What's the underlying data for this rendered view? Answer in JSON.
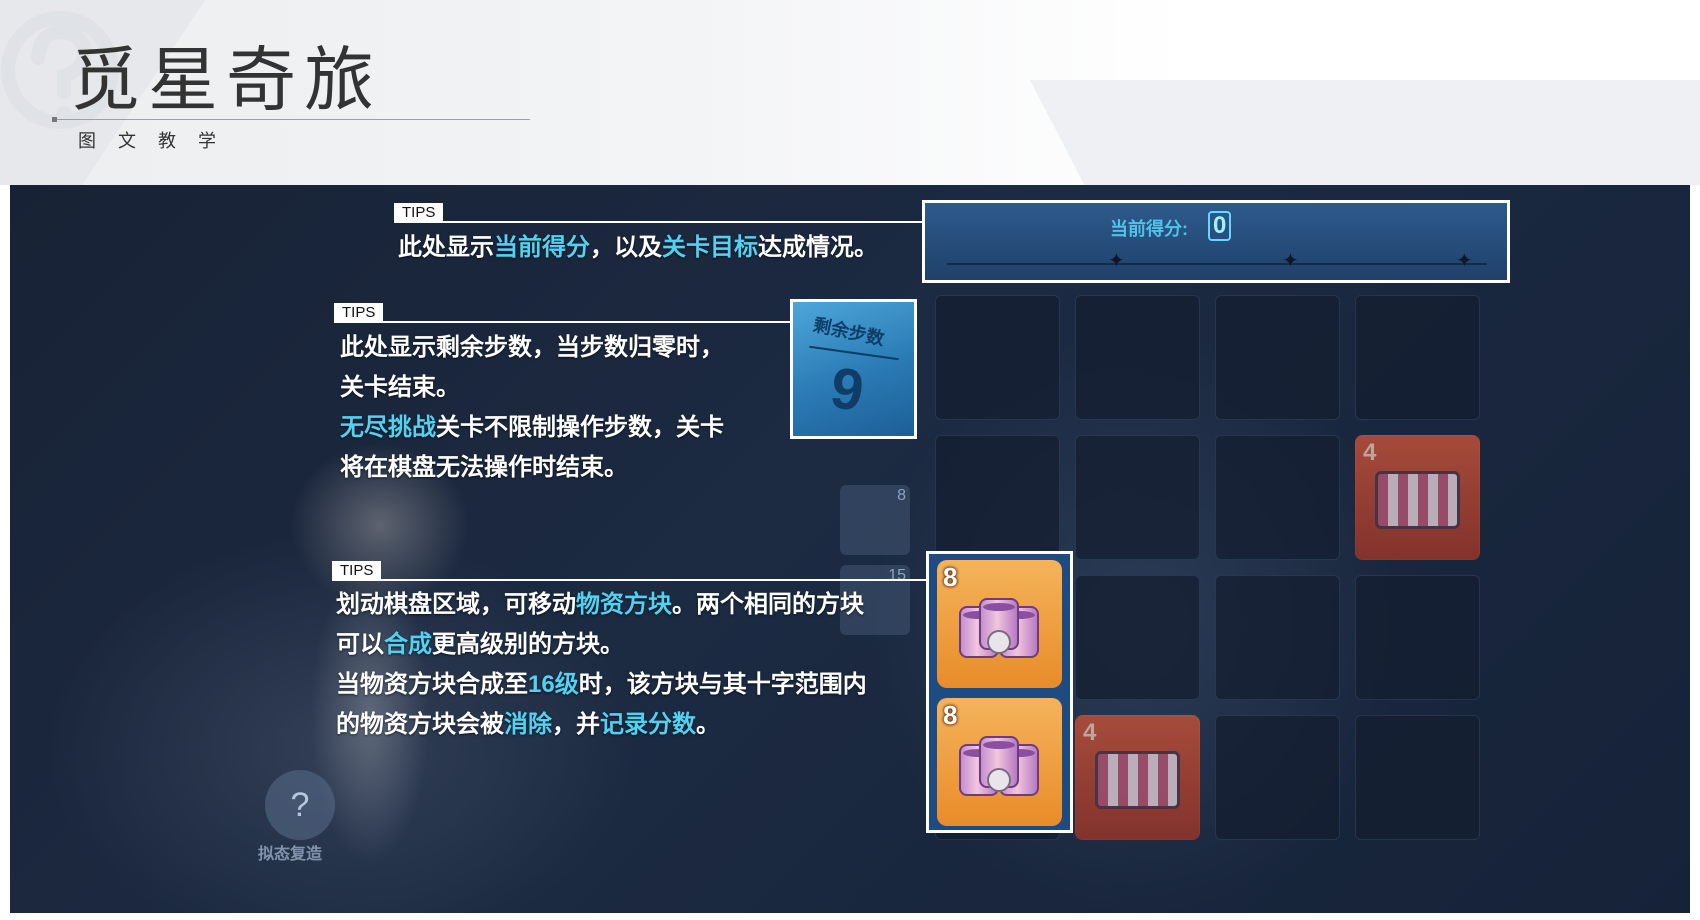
{
  "header": {
    "title": "觅星奇旅",
    "subtitle": "图文教学"
  },
  "game": {
    "score": {
      "label": "当前得分:",
      "value": "0"
    },
    "steps": {
      "label": "剩余步数",
      "value": "9"
    },
    "board_tiles": [
      {
        "level": "4"
      },
      {
        "level": "4"
      }
    ],
    "side_slots": [
      {
        "count": "8"
      },
      {
        "count": "15"
      }
    ],
    "stack_tiles": [
      {
        "level": "8"
      },
      {
        "level": "8"
      }
    ],
    "skill": {
      "icon": "question-card-icon",
      "label": "拟态复造"
    }
  },
  "tips": [
    {
      "tag": "TIPS",
      "lines": [
        [
          {
            "t": "此处显示"
          },
          {
            "t": "当前得分",
            "hl": true
          },
          {
            "t": "，以及"
          },
          {
            "t": "关卡目标",
            "hl": true
          },
          {
            "t": "达成情况。"
          }
        ]
      ]
    },
    {
      "tag": "TIPS",
      "lines": [
        [
          {
            "t": "此处显示剩余步数，当步数归零时，"
          }
        ],
        [
          {
            "t": "关卡结束。"
          }
        ],
        [
          {
            "t": "无尽挑战",
            "hl": true
          },
          {
            "t": "关卡不限制操作步数，关卡"
          }
        ],
        [
          {
            "t": "将在棋盘无法操作时结束。"
          }
        ]
      ]
    },
    {
      "tag": "TIPS",
      "lines": [
        [
          {
            "t": "划动棋盘区域，可移动"
          },
          {
            "t": "物资方块",
            "hl": true
          },
          {
            "t": "。两个相同的方块"
          }
        ],
        [
          {
            "t": "可以"
          },
          {
            "t": "合成",
            "hl": true
          },
          {
            "t": "更高级别的方块。"
          }
        ],
        [
          {
            "t": "当物资方块合成至"
          },
          {
            "t": "16级",
            "hl": true
          },
          {
            "t": "时，该方块与其十字范围内"
          }
        ],
        [
          {
            "t": "的物资方块会被"
          },
          {
            "t": "消除",
            "hl": true
          },
          {
            "t": "，并"
          },
          {
            "t": "记录分数",
            "hl": true
          },
          {
            "t": "。"
          }
        ]
      ]
    }
  ],
  "colors": {
    "highlight": "#52d1f0",
    "panel": "#243754",
    "tile": "#e88c2a"
  }
}
